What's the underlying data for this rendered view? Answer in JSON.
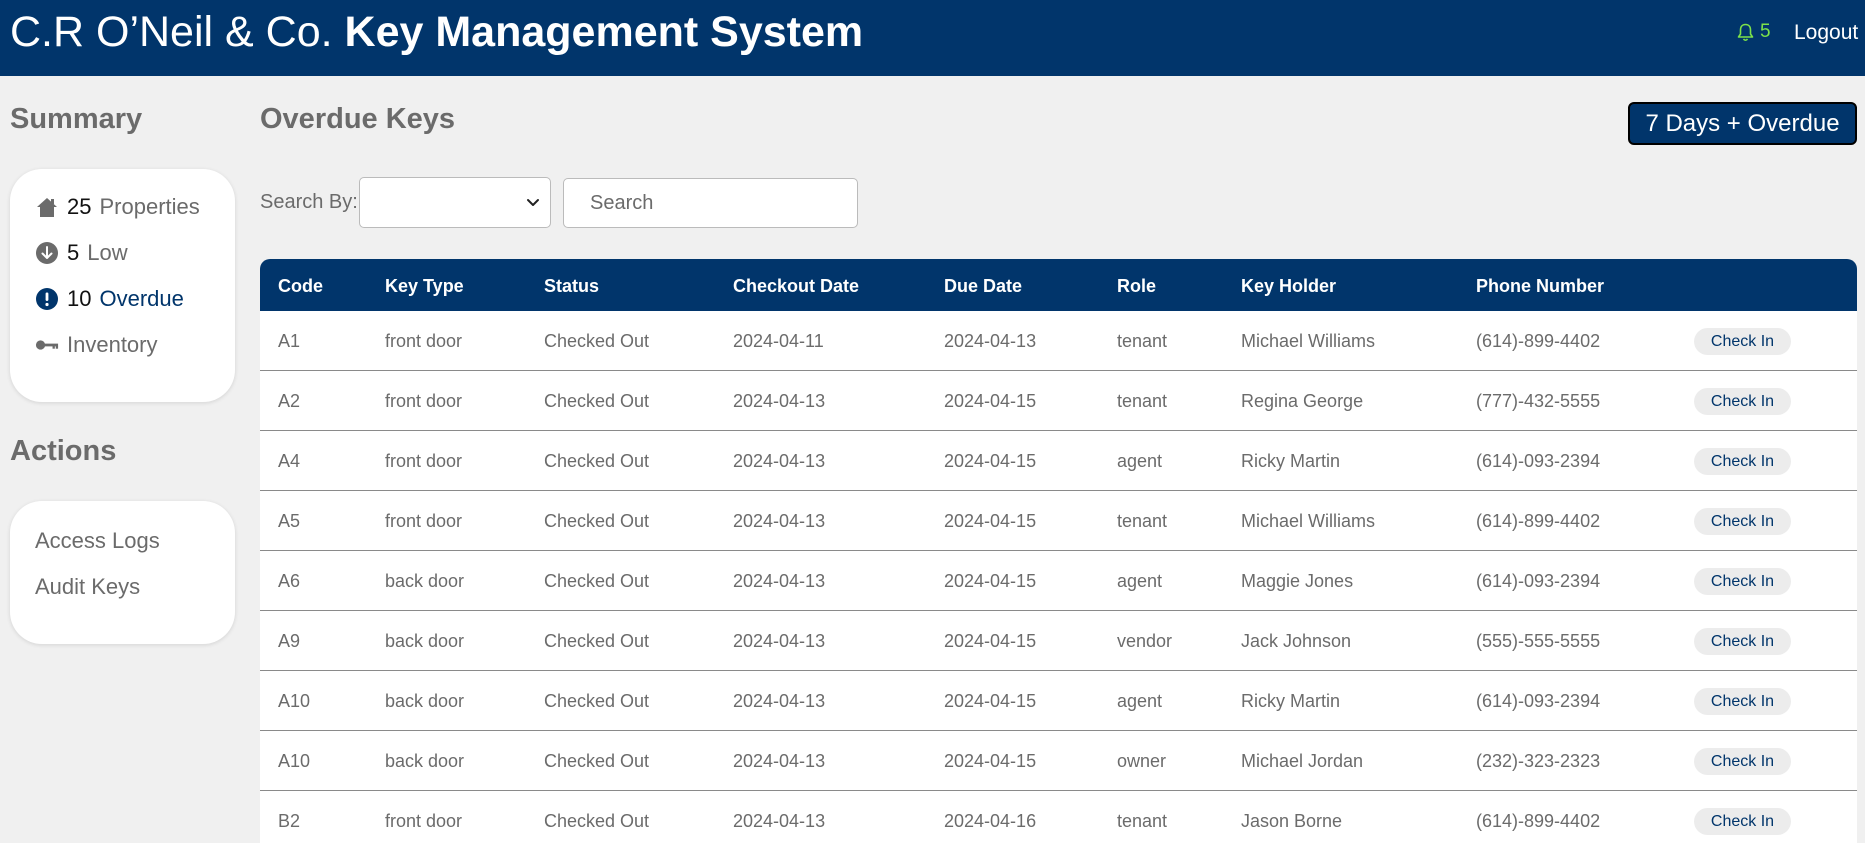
{
  "header": {
    "company": "C.R O’Neil & Co.",
    "product": "Key Management System",
    "notification_count": "5",
    "logout_label": "Logout"
  },
  "summary": {
    "heading": "Summary",
    "properties": {
      "count": "25",
      "label": "Properties",
      "icon": "house-icon"
    },
    "low": {
      "count": "5",
      "label": "Low",
      "icon": "arrow-down-circle-icon"
    },
    "overdue": {
      "count": "10",
      "label": "Overdue",
      "icon": "exclamation-circle-icon"
    },
    "inventory": {
      "label": "Inventory",
      "icon": "key-icon"
    }
  },
  "actions": {
    "heading": "Actions",
    "items": [
      "Access Logs",
      "Audit Keys"
    ]
  },
  "main": {
    "title": "Overdue Keys",
    "filter_button": "7 Days + Overdue",
    "search_by_label": "Search By:",
    "search_select_value": "",
    "search_placeholder": "Search"
  },
  "table": {
    "columns": [
      "Code",
      "Key Type",
      "Status",
      "Checkout Date",
      "Due Date",
      "Role",
      "Key Holder",
      "Phone Number"
    ],
    "action_label": "Check In",
    "rows": [
      [
        "A1",
        "front door",
        "Checked Out",
        "2024-04-11",
        "2024-04-13",
        "tenant",
        "Michael Williams",
        "(614)-899-4402"
      ],
      [
        "A2",
        "front door",
        "Checked Out",
        "2024-04-13",
        "2024-04-15",
        "tenant",
        "Regina George",
        "(777)-432-5555"
      ],
      [
        "A4",
        "front door",
        "Checked Out",
        "2024-04-13",
        "2024-04-15",
        "agent",
        "Ricky Martin",
        "(614)-093-2394"
      ],
      [
        "A5",
        "front door",
        "Checked Out",
        "2024-04-13",
        "2024-04-15",
        "tenant",
        "Michael Williams",
        "(614)-899-4402"
      ],
      [
        "A6",
        "back door",
        "Checked Out",
        "2024-04-13",
        "2024-04-15",
        "agent",
        "Maggie Jones",
        "(614)-093-2394"
      ],
      [
        "A9",
        "back door",
        "Checked Out",
        "2024-04-13",
        "2024-04-15",
        "vendor",
        "Jack Johnson",
        "(555)-555-5555"
      ],
      [
        "A10",
        "back door",
        "Checked Out",
        "2024-04-13",
        "2024-04-15",
        "agent",
        "Ricky Martin",
        "(614)-093-2394"
      ],
      [
        "A10",
        "back door",
        "Checked Out",
        "2024-04-13",
        "2024-04-15",
        "owner",
        "Michael Jordan",
        "(232)-323-2323"
      ],
      [
        "B2",
        "front door",
        "Checked Out",
        "2024-04-13",
        "2024-04-16",
        "tenant",
        "Jason Borne",
        "(614)-899-4402"
      ]
    ]
  },
  "colors": {
    "brand": "#01356b",
    "notification": "#7ce24a",
    "text": "#6b6b6b",
    "background": "#f0f0f0"
  }
}
